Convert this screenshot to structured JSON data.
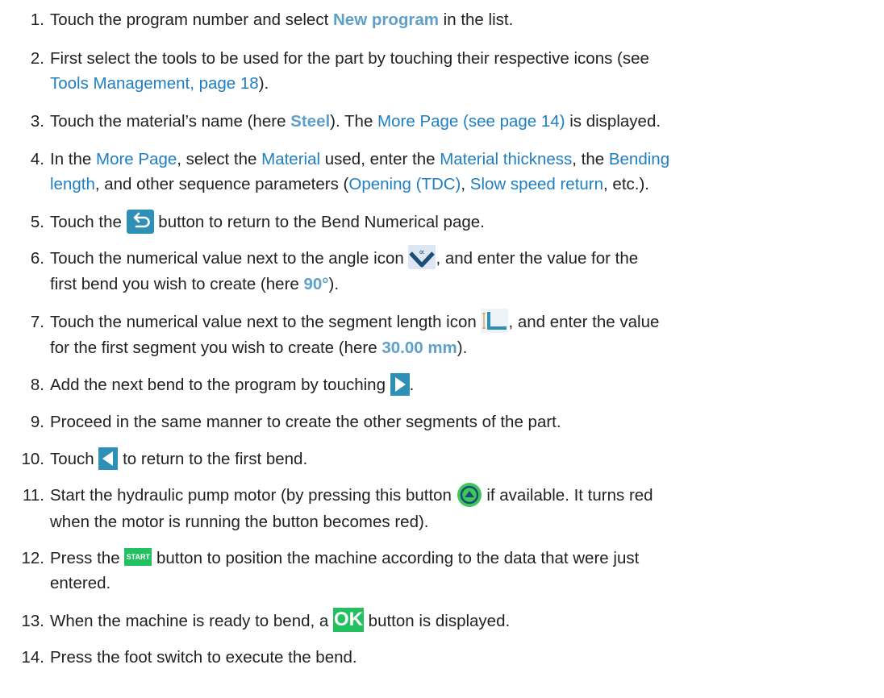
{
  "steps": [
    {
      "num": "1.",
      "parts": [
        "Touch the program number and select ",
        "New program",
        " in the list."
      ]
    },
    {
      "num": "2.",
      "parts": [
        "First select the tools to be used for the part by touching their respective icons (see",
        "Tools Management, page 18",
        ")."
      ]
    },
    {
      "num": "3.",
      "parts": [
        "Touch the material’s name (here ",
        "Steel",
        "). The ",
        "More Page (see page 14)",
        " is displayed."
      ]
    },
    {
      "num": "4.",
      "parts": [
        "In the ",
        "More Page",
        ", select the ",
        "Material",
        " used, enter the ",
        "Material thickness",
        ", the ",
        "Bending",
        "length",
        ", and other sequence parameters (",
        "Opening (TDC)",
        ", ",
        "Slow speed return",
        ", etc.)."
      ]
    },
    {
      "num": "5.",
      "parts": [
        "Touch the ",
        " button to return to the Bend Numerical page."
      ]
    },
    {
      "num": "6.",
      "parts": [
        "Touch the numerical value next to the angle icon ",
        ", and enter the value for the",
        "first bend you wish to create (here ",
        "90°",
        ")."
      ]
    },
    {
      "num": "7.",
      "parts": [
        "Touch the numerical value next to the segment length icon ",
        ", and enter the value",
        "for the first segment you wish to create (here ",
        "30.00 mm",
        ")."
      ]
    },
    {
      "num": "8.",
      "parts": [
        "Add the next bend to the program by touching ",
        "."
      ]
    },
    {
      "num": "9.",
      "parts": [
        "Proceed in the same manner to create the other segments of the part."
      ]
    },
    {
      "num": "10.",
      "parts": [
        "Touch ",
        " to return to the first bend."
      ]
    },
    {
      "num": "11.",
      "parts": [
        "Start the hydraulic pump motor (by pressing this button ",
        " if available. It turns red",
        "when the motor is running the button becomes red)."
      ]
    },
    {
      "num": "12.",
      "parts": [
        "Press the ",
        " button to position the machine according to the data that were just",
        "entered."
      ]
    },
    {
      "num": "13.",
      "parts": [
        "When the machine is ready to bend, a ",
        " button is displayed."
      ]
    },
    {
      "num": "14.",
      "parts": [
        "Press the foot switch to execute the bend."
      ]
    }
  ],
  "icons": {
    "back": "back-arrow-icon",
    "angle": "angle-icon",
    "segment": "segment-length-icon",
    "next": "next-bend-icon",
    "prev": "previous-bend-icon",
    "pump": "pump-motor-icon",
    "start": "start-button-icon",
    "ok": "ok-button-icon"
  },
  "icon_labels": {
    "start": "START",
    "ok": "OK"
  },
  "colors": {
    "link": "#1f7fc3",
    "highlight": "#5ea0c8",
    "button": "#2e8fb7",
    "ok": "#22c060",
    "pump": "#3cc85a"
  }
}
